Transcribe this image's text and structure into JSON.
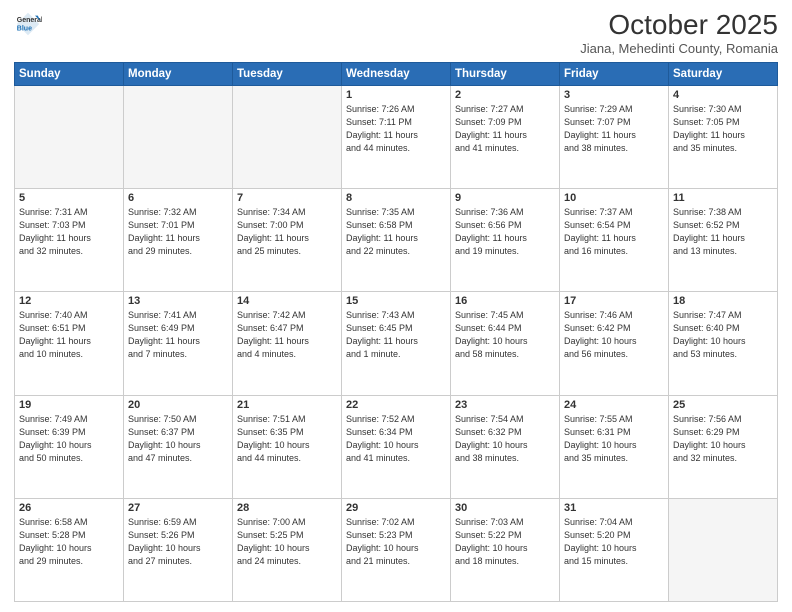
{
  "logo": {
    "general": "General",
    "blue": "Blue"
  },
  "title": "October 2025",
  "location": "Jiana, Mehedinti County, Romania",
  "weekdays": [
    "Sunday",
    "Monday",
    "Tuesday",
    "Wednesday",
    "Thursday",
    "Friday",
    "Saturday"
  ],
  "weeks": [
    [
      {
        "day": "",
        "info": ""
      },
      {
        "day": "",
        "info": ""
      },
      {
        "day": "",
        "info": ""
      },
      {
        "day": "1",
        "info": "Sunrise: 7:26 AM\nSunset: 7:11 PM\nDaylight: 11 hours\nand 44 minutes."
      },
      {
        "day": "2",
        "info": "Sunrise: 7:27 AM\nSunset: 7:09 PM\nDaylight: 11 hours\nand 41 minutes."
      },
      {
        "day": "3",
        "info": "Sunrise: 7:29 AM\nSunset: 7:07 PM\nDaylight: 11 hours\nand 38 minutes."
      },
      {
        "day": "4",
        "info": "Sunrise: 7:30 AM\nSunset: 7:05 PM\nDaylight: 11 hours\nand 35 minutes."
      }
    ],
    [
      {
        "day": "5",
        "info": "Sunrise: 7:31 AM\nSunset: 7:03 PM\nDaylight: 11 hours\nand 32 minutes."
      },
      {
        "day": "6",
        "info": "Sunrise: 7:32 AM\nSunset: 7:01 PM\nDaylight: 11 hours\nand 29 minutes."
      },
      {
        "day": "7",
        "info": "Sunrise: 7:34 AM\nSunset: 7:00 PM\nDaylight: 11 hours\nand 25 minutes."
      },
      {
        "day": "8",
        "info": "Sunrise: 7:35 AM\nSunset: 6:58 PM\nDaylight: 11 hours\nand 22 minutes."
      },
      {
        "day": "9",
        "info": "Sunrise: 7:36 AM\nSunset: 6:56 PM\nDaylight: 11 hours\nand 19 minutes."
      },
      {
        "day": "10",
        "info": "Sunrise: 7:37 AM\nSunset: 6:54 PM\nDaylight: 11 hours\nand 16 minutes."
      },
      {
        "day": "11",
        "info": "Sunrise: 7:38 AM\nSunset: 6:52 PM\nDaylight: 11 hours\nand 13 minutes."
      }
    ],
    [
      {
        "day": "12",
        "info": "Sunrise: 7:40 AM\nSunset: 6:51 PM\nDaylight: 11 hours\nand 10 minutes."
      },
      {
        "day": "13",
        "info": "Sunrise: 7:41 AM\nSunset: 6:49 PM\nDaylight: 11 hours\nand 7 minutes."
      },
      {
        "day": "14",
        "info": "Sunrise: 7:42 AM\nSunset: 6:47 PM\nDaylight: 11 hours\nand 4 minutes."
      },
      {
        "day": "15",
        "info": "Sunrise: 7:43 AM\nSunset: 6:45 PM\nDaylight: 11 hours\nand 1 minute."
      },
      {
        "day": "16",
        "info": "Sunrise: 7:45 AM\nSunset: 6:44 PM\nDaylight: 10 hours\nand 58 minutes."
      },
      {
        "day": "17",
        "info": "Sunrise: 7:46 AM\nSunset: 6:42 PM\nDaylight: 10 hours\nand 56 minutes."
      },
      {
        "day": "18",
        "info": "Sunrise: 7:47 AM\nSunset: 6:40 PM\nDaylight: 10 hours\nand 53 minutes."
      }
    ],
    [
      {
        "day": "19",
        "info": "Sunrise: 7:49 AM\nSunset: 6:39 PM\nDaylight: 10 hours\nand 50 minutes."
      },
      {
        "day": "20",
        "info": "Sunrise: 7:50 AM\nSunset: 6:37 PM\nDaylight: 10 hours\nand 47 minutes."
      },
      {
        "day": "21",
        "info": "Sunrise: 7:51 AM\nSunset: 6:35 PM\nDaylight: 10 hours\nand 44 minutes."
      },
      {
        "day": "22",
        "info": "Sunrise: 7:52 AM\nSunset: 6:34 PM\nDaylight: 10 hours\nand 41 minutes."
      },
      {
        "day": "23",
        "info": "Sunrise: 7:54 AM\nSunset: 6:32 PM\nDaylight: 10 hours\nand 38 minutes."
      },
      {
        "day": "24",
        "info": "Sunrise: 7:55 AM\nSunset: 6:31 PM\nDaylight: 10 hours\nand 35 minutes."
      },
      {
        "day": "25",
        "info": "Sunrise: 7:56 AM\nSunset: 6:29 PM\nDaylight: 10 hours\nand 32 minutes."
      }
    ],
    [
      {
        "day": "26",
        "info": "Sunrise: 6:58 AM\nSunset: 5:28 PM\nDaylight: 10 hours\nand 29 minutes."
      },
      {
        "day": "27",
        "info": "Sunrise: 6:59 AM\nSunset: 5:26 PM\nDaylight: 10 hours\nand 27 minutes."
      },
      {
        "day": "28",
        "info": "Sunrise: 7:00 AM\nSunset: 5:25 PM\nDaylight: 10 hours\nand 24 minutes."
      },
      {
        "day": "29",
        "info": "Sunrise: 7:02 AM\nSunset: 5:23 PM\nDaylight: 10 hours\nand 21 minutes."
      },
      {
        "day": "30",
        "info": "Sunrise: 7:03 AM\nSunset: 5:22 PM\nDaylight: 10 hours\nand 18 minutes."
      },
      {
        "day": "31",
        "info": "Sunrise: 7:04 AM\nSunset: 5:20 PM\nDaylight: 10 hours\nand 15 minutes."
      },
      {
        "day": "",
        "info": ""
      }
    ]
  ]
}
